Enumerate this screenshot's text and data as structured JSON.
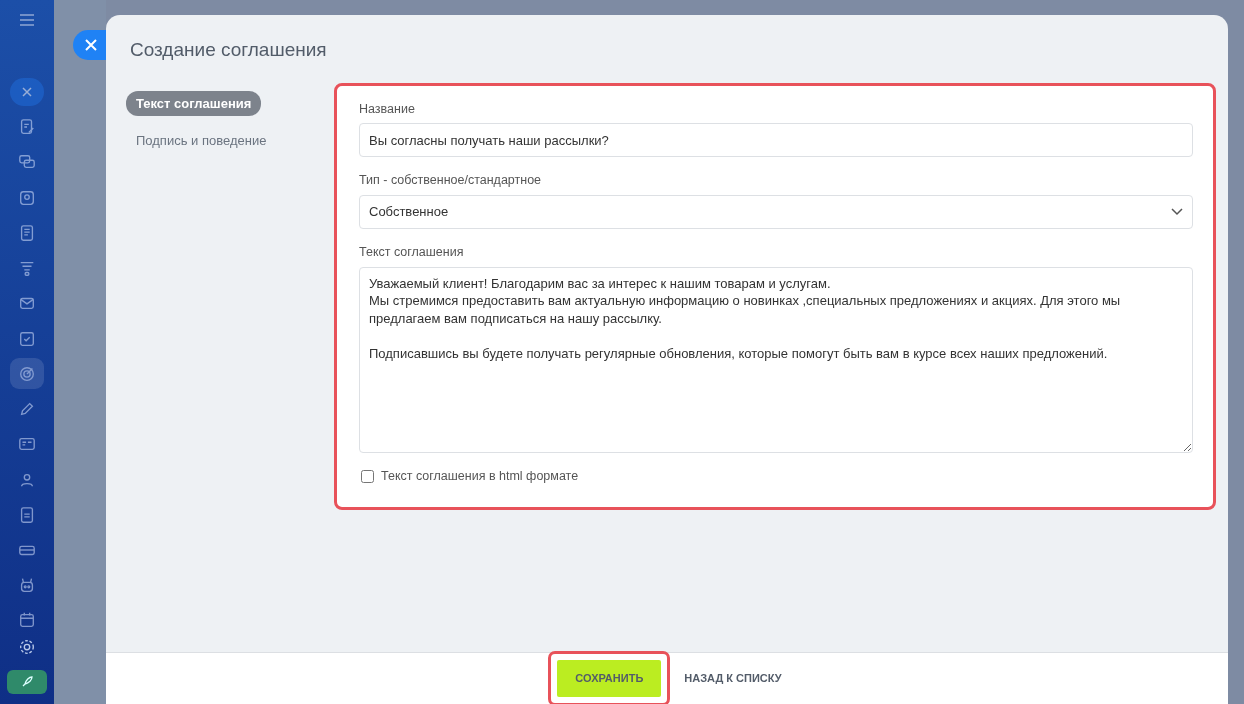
{
  "sidebar": {
    "items": [
      {
        "selected": false
      },
      {
        "selected": false
      },
      {
        "selected": false
      },
      {
        "selected": false
      },
      {
        "selected": false
      },
      {
        "selected": false
      },
      {
        "selected": false
      },
      {
        "selected": true
      },
      {
        "selected": false
      },
      {
        "selected": false
      },
      {
        "selected": false
      },
      {
        "selected": false
      },
      {
        "selected": false
      },
      {
        "selected": false
      },
      {
        "selected": false
      }
    ]
  },
  "slider": {
    "title": "Создание соглашения"
  },
  "tabs": [
    {
      "label": "Текст соглашения",
      "selected": true
    },
    {
      "label": "Подпись и поведение",
      "selected": false
    }
  ],
  "form": {
    "name_label": "Название",
    "name_value": "Вы согласны получать наши рассылки?",
    "type_label": "Тип - собственное/стандартное",
    "type_value": "Собственное",
    "text_label": "Текст соглашения",
    "text_value": "Уважаемый клиент! Благодарим вас за интерес к нашим товарам и услугам.\nМы стремимся предоставить вам актуальную информацию о новинках ,специальных предложениях и акциях. Для этого мы предлагаем вам подписаться на нашу рассылку.\n\nПодписавшись вы будете получать регулярные обновления, которые помогут быть вам в курсе всех наших предложений.",
    "html_checkbox": {
      "label": "Текст соглашения в html формате",
      "checked": false
    }
  },
  "footer": {
    "buttons": [
      {
        "label": "СОХРАНИТЬ",
        "kind": "primary"
      },
      {
        "label": "НАЗАД К СПИСКУ",
        "kind": "link"
      }
    ]
  }
}
